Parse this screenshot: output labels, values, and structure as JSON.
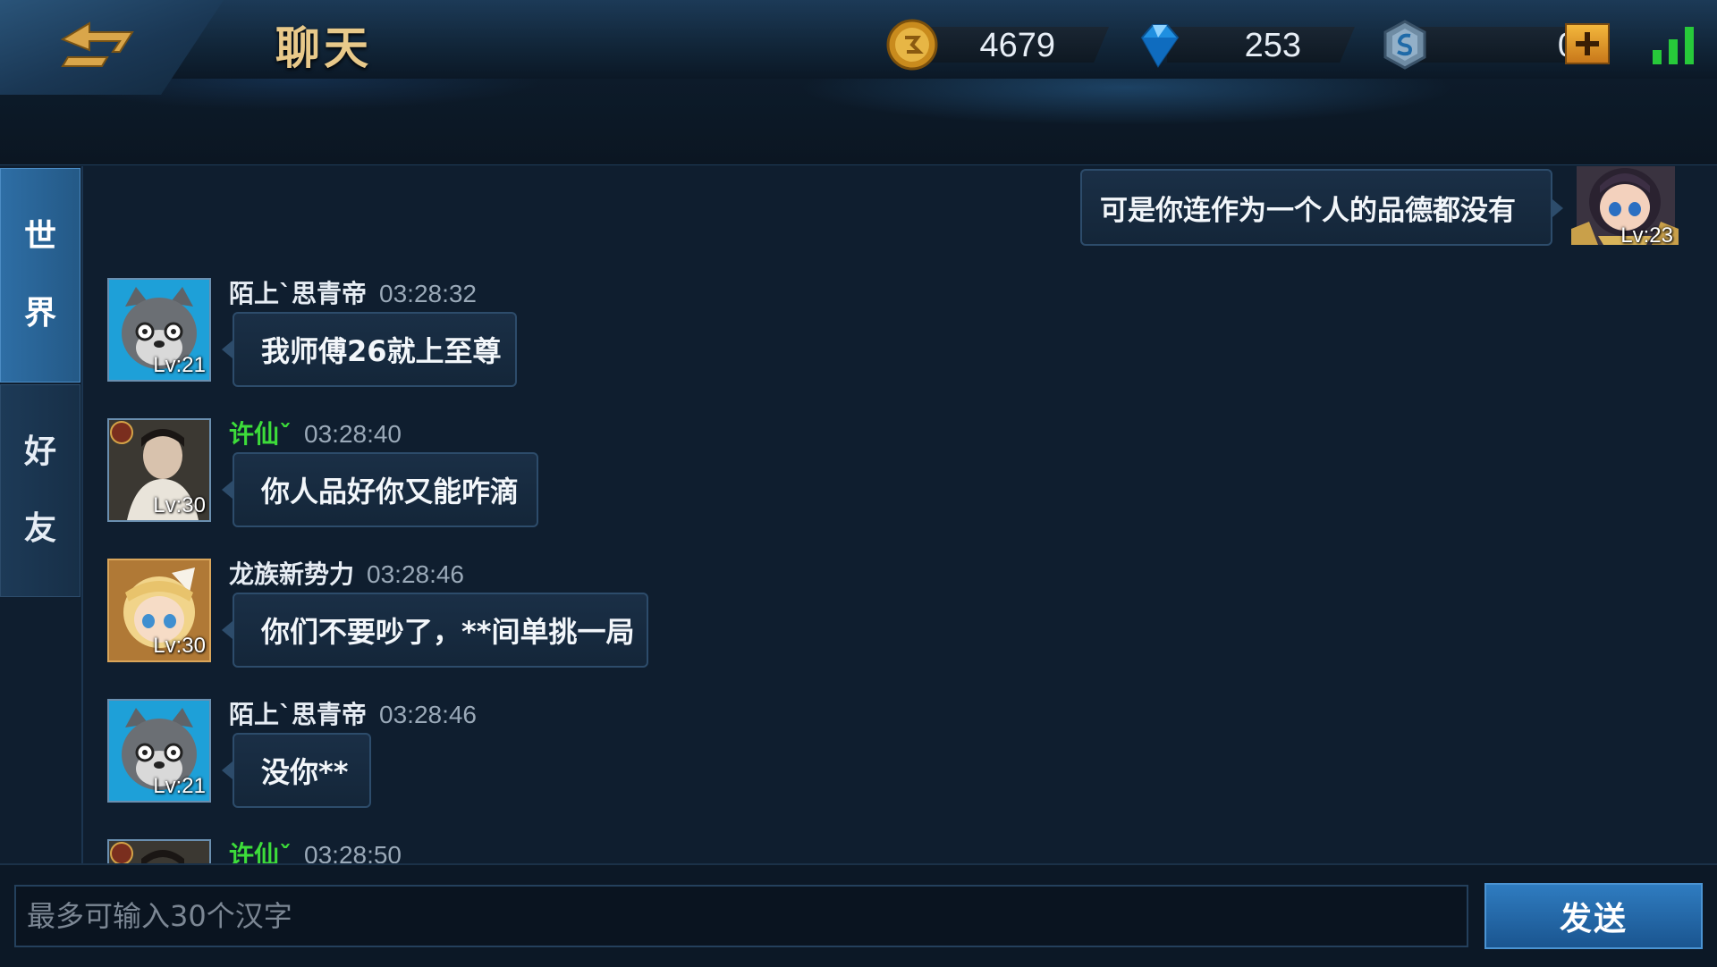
{
  "header": {
    "title": "聊天",
    "gold": "4679",
    "diamonds": "253",
    "tokens": "0"
  },
  "tabs": [
    {
      "label_top": "世",
      "label_bottom": "界",
      "active": true
    },
    {
      "label_top": "好",
      "label_bottom": "友",
      "active": false
    }
  ],
  "own_message": {
    "text": "可是你连作为一个人的品德都没有",
    "level": "Lv:23"
  },
  "messages": [
    {
      "name": "陌上`思青帝",
      "time": "03:28:32",
      "text": "我师傅26就上至尊",
      "level": "Lv:21",
      "name_color": "#e6ecf3",
      "avatar": "wolf-avatar"
    },
    {
      "name": "许仙ˇ",
      "time": "03:28:40",
      "text": "你人品好你又能咋滴",
      "level": "Lv:30",
      "name_color": "#3ddc3a",
      "avatar": "photo-avatar"
    },
    {
      "name": "龙族新势力",
      "time": "03:28:46",
      "text": "你们不要吵了，**间单挑一局",
      "level": "Lv:30",
      "name_color": "#e6ecf3",
      "avatar": "anime-girl-avatar"
    },
    {
      "name": "陌上`思青帝",
      "time": "03:28:46",
      "text": "没你**",
      "level": "Lv:21",
      "name_color": "#e6ecf3",
      "avatar": "wolf-avatar"
    },
    {
      "name": "许仙ˇ",
      "time": "03:28:50",
      "name_color": "#3ddc3a",
      "avatar": "photo-avatar"
    }
  ],
  "input": {
    "placeholder": "最多可输入30个汉字",
    "value": ""
  },
  "send_label": "发送",
  "colors": {
    "accent_blue": "#2f7cc0",
    "vip_name_green": "#3ddc3a",
    "title_gold": "#e8c98a"
  }
}
